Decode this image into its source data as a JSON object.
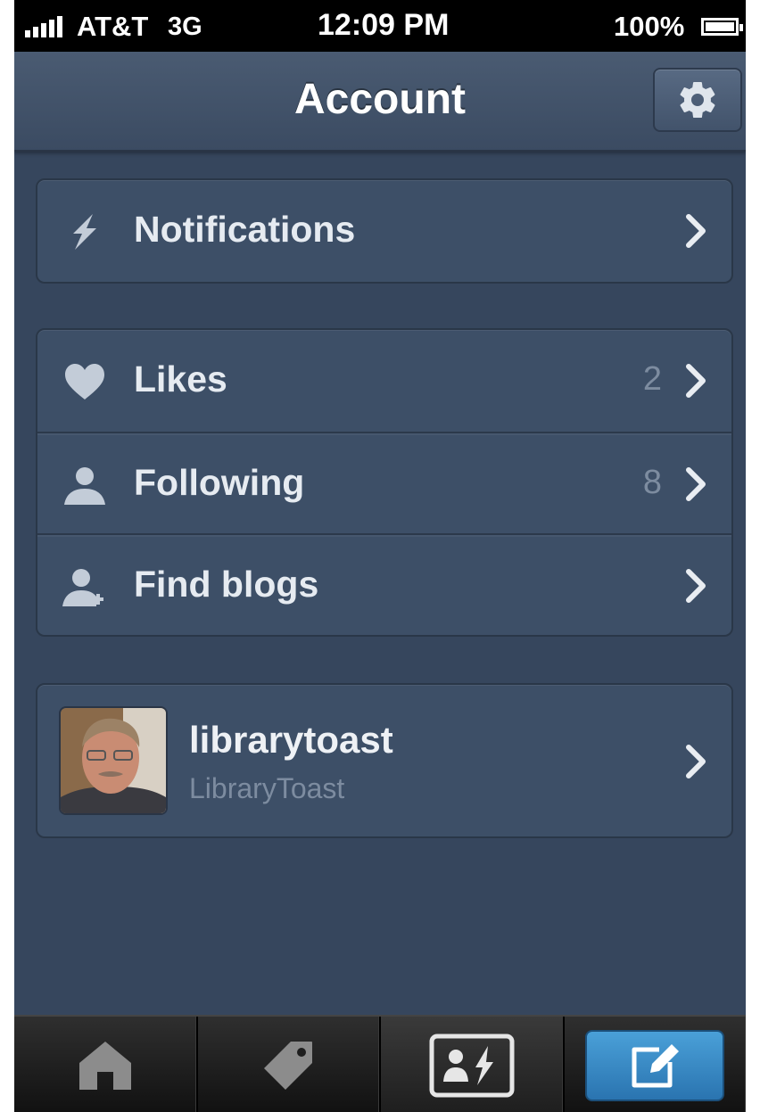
{
  "status_bar": {
    "carrier": "AT&T",
    "network": "3G",
    "time": "12:09 PM",
    "battery": "100%"
  },
  "nav": {
    "title": "Account",
    "settings_icon": "gear-icon"
  },
  "notifications": {
    "label": "Notifications",
    "icon": "lightning-icon"
  },
  "menu": {
    "items": [
      {
        "label": "Likes",
        "count": "2",
        "icon": "heart-icon"
      },
      {
        "label": "Following",
        "count": "8",
        "icon": "person-icon"
      },
      {
        "label": "Find blogs",
        "count": "",
        "icon": "person-add-icon"
      }
    ]
  },
  "profile": {
    "username": "librarytoast",
    "blog_title": "LibraryToast"
  },
  "tab_bar": {
    "tabs": [
      {
        "icon": "home-icon"
      },
      {
        "icon": "tag-icon"
      },
      {
        "icon": "activity-icon",
        "selected": true
      },
      {
        "icon": "compose-icon"
      }
    ]
  },
  "colors": {
    "background": "#36465d",
    "accent_blue": "#3a8ccc"
  }
}
